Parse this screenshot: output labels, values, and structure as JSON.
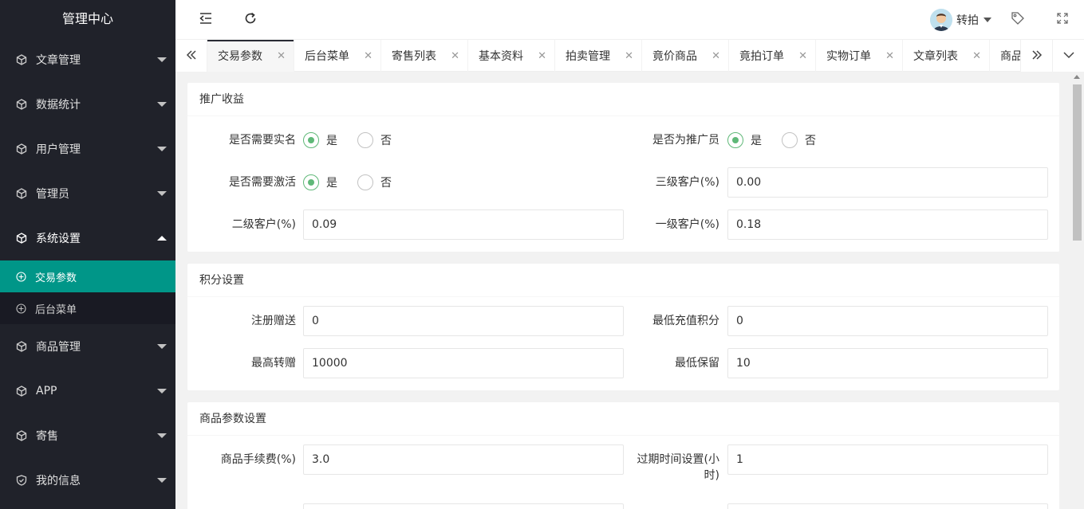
{
  "app": {
    "title": "管理中心"
  },
  "sidebar": {
    "items": [
      {
        "label": "文章管理"
      },
      {
        "label": "数据统计"
      },
      {
        "label": "用户管理"
      },
      {
        "label": "管理员"
      },
      {
        "label": "系统设置",
        "sub": [
          {
            "label": "交易参数"
          },
          {
            "label": "后台菜单"
          }
        ]
      },
      {
        "label": "商品管理"
      },
      {
        "label": "APP"
      },
      {
        "label": "寄售"
      },
      {
        "label": "我的信息"
      }
    ]
  },
  "header": {
    "username": "转拍",
    "icons": [
      "collapse-icon",
      "refresh-icon",
      "tag-icon",
      "fullscreen-icon"
    ]
  },
  "tabs": [
    {
      "label": "交易参数",
      "active": true
    },
    {
      "label": "后台菜单"
    },
    {
      "label": "寄售列表"
    },
    {
      "label": "基本资料"
    },
    {
      "label": "拍卖管理"
    },
    {
      "label": "竟价商品"
    },
    {
      "label": "竟拍订单"
    },
    {
      "label": "实物订单"
    },
    {
      "label": "文章列表"
    },
    {
      "label": "商品"
    }
  ],
  "sections": {
    "promo": {
      "title": "推广收益",
      "realname": {
        "label": "是否需要实名",
        "yes": "是",
        "no": "否",
        "selected": "是"
      },
      "promoter": {
        "label": "是否为推广员",
        "yes": "是",
        "no": "否",
        "selected": "是"
      },
      "activate": {
        "label": "是否需要激活",
        "yes": "是",
        "no": "否",
        "selected": "是"
      },
      "level3": {
        "label": "三级客户(%)",
        "value": "0.00"
      },
      "level2": {
        "label": "二级客户(%)",
        "value": "0.09"
      },
      "level1": {
        "label": "一级客户(%)",
        "value": "0.18"
      }
    },
    "points": {
      "title": "积分设置",
      "register": {
        "label": "注册赠送",
        "value": "0"
      },
      "min_recharge": {
        "label": "最低充值积分",
        "value": "0"
      },
      "max_transfer": {
        "label": "最高转赠",
        "value": "10000"
      },
      "min_keep": {
        "label": "最低保留",
        "value": "10"
      }
    },
    "goods": {
      "title": "商品参数设置",
      "fee": {
        "label": "商品手续费(%)",
        "value": "3.0"
      },
      "expire": {
        "label_line1": "过期时间设置(小",
        "label_line2": "时)",
        "value": "1"
      }
    }
  },
  "colors": {
    "sidebar_bg": "#20222a",
    "accent": "#009688",
    "radio": "#5fb878"
  }
}
